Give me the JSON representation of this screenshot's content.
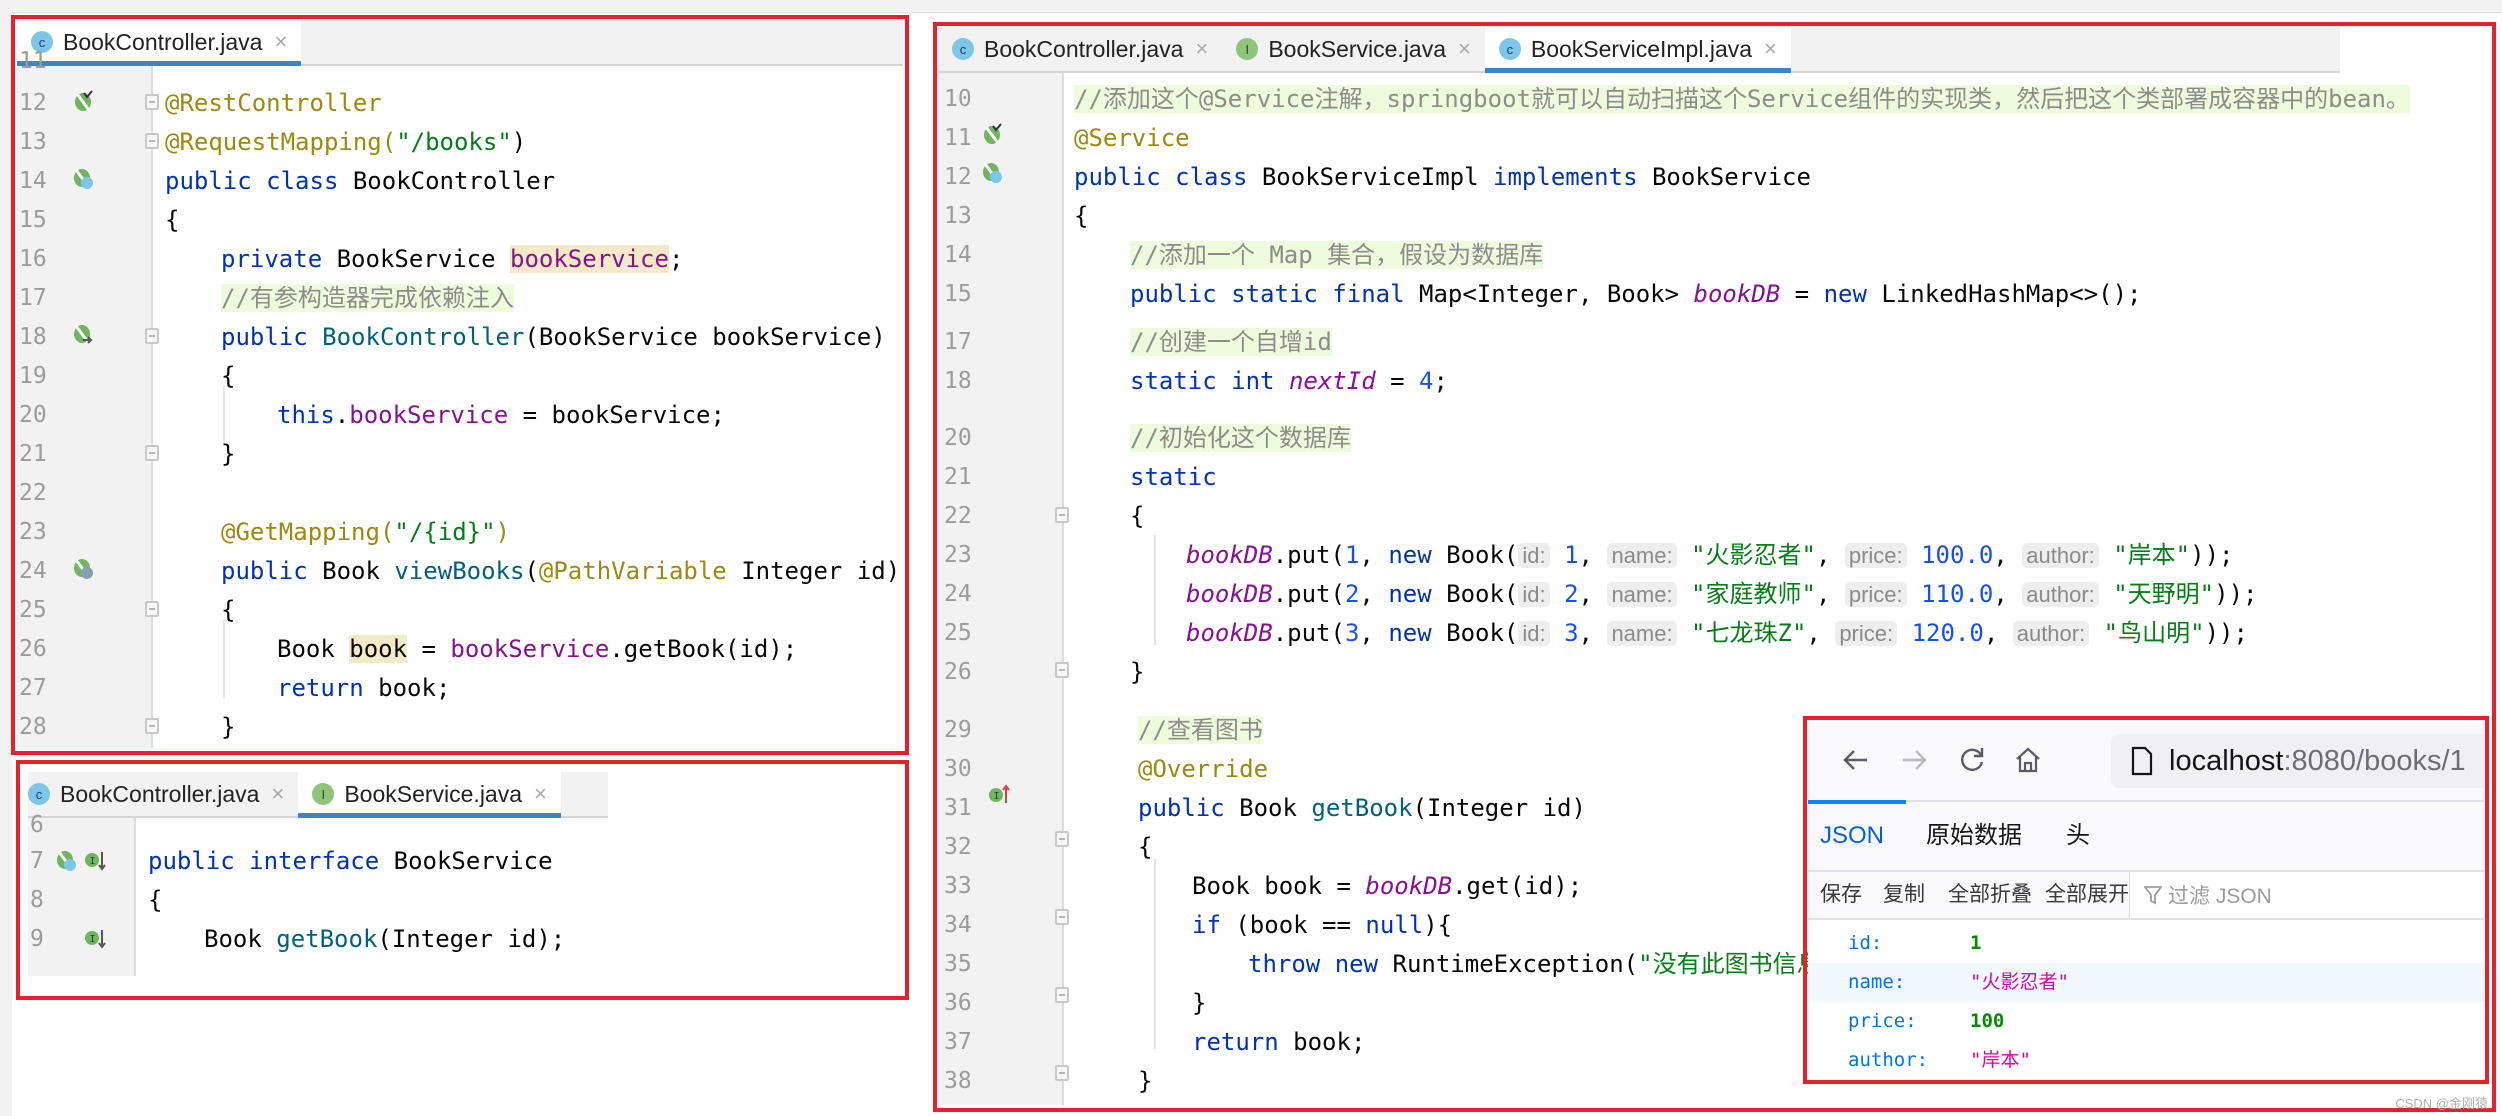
{
  "panel_controller": {
    "tabs": [
      {
        "icon": "C",
        "label": "BookController.java",
        "active": true
      }
    ],
    "lines": [
      {
        "n": "11",
        "partial": true
      },
      {
        "n": "12"
      },
      {
        "n": "13"
      },
      {
        "n": "14"
      },
      {
        "n": "15"
      },
      {
        "n": "16"
      },
      {
        "n": "17"
      },
      {
        "n": "18"
      },
      {
        "n": "19"
      },
      {
        "n": "20"
      },
      {
        "n": "21"
      },
      {
        "n": "22"
      },
      {
        "n": "23"
      },
      {
        "n": "24"
      },
      {
        "n": "25"
      },
      {
        "n": "26"
      },
      {
        "n": "27"
      },
      {
        "n": "28"
      }
    ],
    "code": {
      "l12": "@RestController",
      "l13a": "@RequestMapping(",
      "l13b": "\"/books\"",
      "l13c": ")",
      "l14a": "public class",
      "l14b": " BookController",
      "l15": "{",
      "l16a": "private",
      "l16b": " BookService ",
      "l16c": "bookService",
      "l16d": ";",
      "l17": "//有参构造器完成依赖注入",
      "l18a": "public",
      "l18b": " BookController",
      "l18c": "(BookService bookService)",
      "l19": "{",
      "l20a": "this",
      "l20b": ".",
      "l20c": "bookService",
      "l20d": " = bookService;",
      "l21": "}",
      "l23a": "@GetMapping(",
      "l23b": "\"/{id}\"",
      "l23c": ")",
      "l24a": "public",
      "l24b": " Book ",
      "l24c": "viewBooks",
      "l24d": "(",
      "l24e": "@PathVariable",
      "l24f": " Integer id)",
      "l25": "{",
      "l26a": "Book ",
      "l26b": "book",
      "l26c": " = ",
      "l26d": "bookService",
      "l26e": ".getBook(id);",
      "l27a": "return",
      "l27b": " book;",
      "l28": "}"
    }
  },
  "panel_service": {
    "tabs": [
      {
        "icon": "C",
        "label": "BookController.java",
        "active": false
      },
      {
        "icon": "I",
        "label": "BookService.java",
        "active": true
      }
    ],
    "lines": [
      "6",
      "7",
      "8",
      "9"
    ],
    "code": {
      "l7a": "public interface",
      "l7b": " BookService",
      "l8": "{",
      "l9a": "Book ",
      "l9b": "getBook",
      "l9c": "(Integer id);"
    }
  },
  "panel_impl": {
    "tabs": [
      {
        "icon": "C",
        "label": "BookController.java",
        "active": false
      },
      {
        "icon": "I",
        "label": "BookService.java",
        "active": false
      },
      {
        "icon": "C",
        "label": "BookServiceImpl.java",
        "active": true
      }
    ],
    "lines": [
      "10",
      "11",
      "12",
      "13",
      "14",
      "15",
      "17",
      "18",
      "20",
      "21",
      "22",
      "23",
      "24",
      "25",
      "26",
      "29",
      "30",
      "31",
      "32",
      "33",
      "34",
      "35",
      "36",
      "37",
      "38"
    ],
    "code": {
      "l10": "//添加这个@Service注解，springboot就可以自动扫描这个Service组件的实现类，然后把这个类部署成容器中的bean。",
      "l11": "@Service",
      "l12a": "public class",
      "l12b": " BookServiceImpl ",
      "l12c": "implements",
      "l12d": " BookService",
      "l13": "{",
      "l14": "//添加一个 Map 集合，假设为数据库",
      "l15a": "public static final",
      "l15b": " Map<Integer, Book> ",
      "l15c": "bookDB",
      "l15d": " = ",
      "l15e": "new",
      "l15f": " LinkedHashMap<>();",
      "l17": "//创建一个自增id",
      "l18a": "static int",
      "l18b": " ",
      "l18c": "nextId",
      "l18d": " = ",
      "l18e": "4",
      "l18f": ";",
      "l20": "//初始化这个数据库",
      "l21": "static",
      "l22": "{",
      "l26": "}",
      "l29": "//查看图书",
      "l30": "@Override",
      "l31a": "public",
      "l31b": " Book ",
      "l31c": "getBook",
      "l31d": "(Integer id)",
      "l32": "{",
      "l33a": "Book book = ",
      "l33b": "bookDB",
      "l33c": ".get(id);",
      "l34a": "if",
      "l34b": " (book == ",
      "l34c": "null",
      "l34d": "){",
      "l35a": "throw new",
      "l35b": " RuntimeException(",
      "l35c": "\"没有此图书信息",
      "l36": "}",
      "l37a": "return",
      "l37b": " book;",
      "l38": "}"
    },
    "puts": [
      {
        "key": "1",
        "id": "1",
        "name": "\"火影忍者\"",
        "price": "100.0",
        "author": "\"岸本\""
      },
      {
        "key": "2",
        "id": "2",
        "name": "\"家庭教师\"",
        "price": "110.0",
        "author": "\"天野明\""
      },
      {
        "key": "3",
        "id": "3",
        "name": "\"七龙珠Z\"",
        "price": "120.0",
        "author": "\"鸟山明\""
      }
    ],
    "put_tokens": {
      "db": "bookDB",
      "put": ".put(",
      "comma": ", ",
      "new": "new",
      "book": " Book(",
      "id_hint": "id:",
      "name_hint": "name:",
      "price_hint": "price:",
      "author_hint": "author:",
      "end": "));"
    }
  },
  "browser": {
    "url_host": "localhost",
    "url_rest": ":8080/books/1",
    "tabs": [
      "JSON",
      "原始数据",
      "头"
    ],
    "active_tab": "JSON",
    "toolbar": [
      "保存",
      "复制",
      "全部折叠",
      "全部展开"
    ],
    "filter_placeholder": "过滤 JSON",
    "json": [
      {
        "key": "id:",
        "value": "1",
        "type": "number"
      },
      {
        "key": "name:",
        "value": "\"火影忍者\"",
        "type": "string"
      },
      {
        "key": "price:",
        "value": "100",
        "type": "number"
      },
      {
        "key": "author:",
        "value": "\"岸本\"",
        "type": "string"
      }
    ]
  },
  "watermark": "CSDN @金刚猿"
}
